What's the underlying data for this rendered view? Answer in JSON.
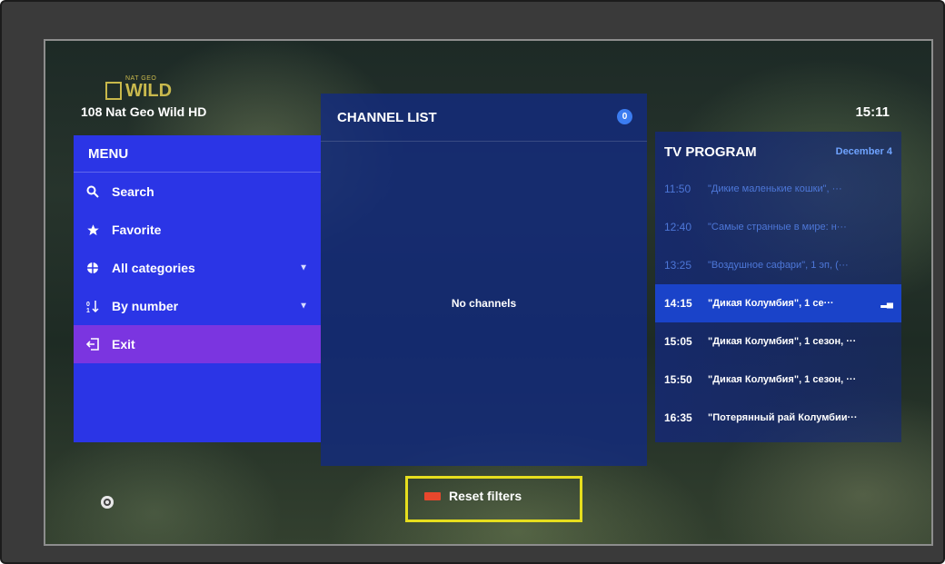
{
  "header": {
    "logo_small": "NAT GEO",
    "logo_big": "WILD",
    "channel": "108 Nat Geo Wild HD",
    "clock": "15:11"
  },
  "menu": {
    "title": "MENU",
    "items": [
      {
        "label": "Search",
        "icon": "search-icon",
        "expandable": false,
        "active": false
      },
      {
        "label": "Favorite",
        "icon": "star-icon",
        "expandable": false,
        "active": false
      },
      {
        "label": "All categories",
        "icon": "categories-icon",
        "expandable": true,
        "active": false
      },
      {
        "label": "By number",
        "icon": "sort-icon",
        "expandable": true,
        "active": false
      },
      {
        "label": "Exit",
        "icon": "exit-icon",
        "expandable": false,
        "active": true
      }
    ]
  },
  "channel_list": {
    "title": "CHANNEL LIST",
    "badge": "0",
    "empty_text": "No channels"
  },
  "tv_program": {
    "title": "TV PROGRAM",
    "date": "December 4",
    "rows": [
      {
        "time": "11:50",
        "name": "\"Дикие маленькие кошки\", ···",
        "state": "past"
      },
      {
        "time": "12:40",
        "name": "\"Самые странные в мире: н···",
        "state": "past"
      },
      {
        "time": "13:25",
        "name": "\"Воздушное сафари\", 1 эп, (···",
        "state": "past"
      },
      {
        "time": "14:15",
        "name": "\"Дикая Колумбия\", 1 се···",
        "state": "current"
      },
      {
        "time": "15:05",
        "name": "\"Дикая Колумбия\", 1 сезон, ···",
        "state": "future"
      },
      {
        "time": "15:50",
        "name": "\"Дикая Колумбия\", 1 сезон, ···",
        "state": "future"
      },
      {
        "time": "16:35",
        "name": "\"Потерянный рай Колумбии···",
        "state": "future"
      }
    ]
  },
  "footer": {
    "reset_label": "Reset filters"
  },
  "colors": {
    "menu_bg": "#2b35e6",
    "menu_active": "#7b35e0",
    "highlight": "#e6de1e",
    "red_key": "#e8472c"
  }
}
